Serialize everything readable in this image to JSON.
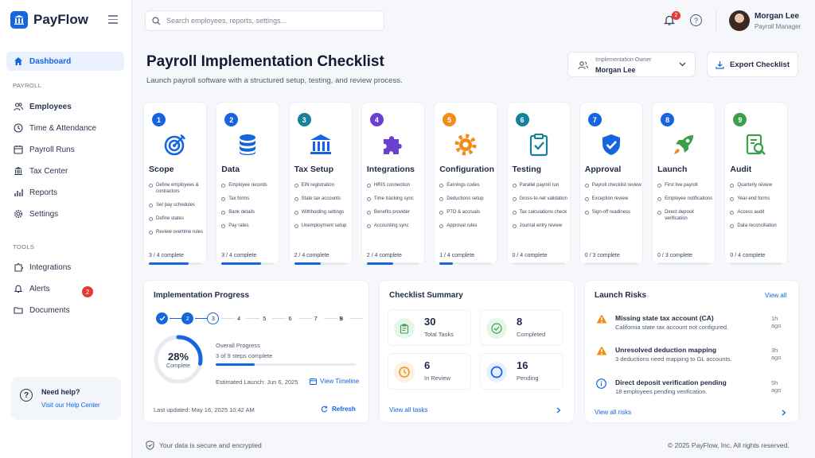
{
  "app": {
    "name": "PayFlow",
    "brand_color": "#1565e0"
  },
  "sidebar": {
    "dashboard": "Dashboard",
    "section_payroll": "PAYROLL",
    "payroll_items": [
      {
        "label": "Employees",
        "icon": "users-icon"
      },
      {
        "label": "Time & Attendance",
        "icon": "clock-icon"
      },
      {
        "label": "Payroll Runs",
        "icon": "calendar-icon"
      },
      {
        "label": "Tax Center",
        "icon": "bank-icon"
      },
      {
        "label": "Reports",
        "icon": "bar-chart-icon"
      },
      {
        "label": "Settings",
        "icon": "gear-icon"
      }
    ],
    "section_tools": "TOOLS",
    "tools_items": [
      {
        "label": "Integrations",
        "icon": "puzzle-icon"
      },
      {
        "label": "Alerts",
        "icon": "bell-icon",
        "badge": "2"
      },
      {
        "label": "Documents",
        "icon": "folder-icon"
      }
    ],
    "help": {
      "title": "Need help?",
      "link": "Visit our Help Center"
    }
  },
  "topbar": {
    "search_placeholder": "Search employees, reports, settings...",
    "notification_count": "2",
    "user": {
      "name": "Morgan Lee",
      "role": "Payroll Manager"
    }
  },
  "header": {
    "title": "Payroll Implementation Checklist",
    "subtitle": "Launch payroll software with a structured setup, testing, and review process.",
    "owner_label": "Implementation Owner",
    "owner_value": "Morgan Lee",
    "export_label": "Export Checklist"
  },
  "stages": [
    {
      "num": "1",
      "name": "Scope",
      "color": "#1565e0",
      "icon": "target-icon",
      "items": [
        "Define employees & contractors",
        "Set pay schedules",
        "Define states",
        "Review overtime rules"
      ],
      "status": "3 / 4 complete",
      "progress": 0.75
    },
    {
      "num": "2",
      "name": "Data",
      "color": "#1565e0",
      "icon": "database-icon",
      "items": [
        "Employee records",
        "Tax forms",
        "Bank details",
        "Pay rates"
      ],
      "status": "3 / 4 complete",
      "progress": 0.75
    },
    {
      "num": "3",
      "name": "Tax Setup",
      "color": "#15829a",
      "icon": "bank-icon",
      "items": [
        "EIN registration",
        "State tax accounts",
        "Withholding settings",
        "Unemployment setup"
      ],
      "status": "2 / 4 complete",
      "progress": 0.5
    },
    {
      "num": "4",
      "name": "Integrations",
      "color": "#6a3fd1",
      "icon": "puzzle-icon",
      "items": [
        "HRIS connection",
        "Time tracking sync",
        "Benefits provider",
        "Accounting sync"
      ],
      "status": "2 / 4 complete",
      "progress": 0.5
    },
    {
      "num": "5",
      "name": "Configuration",
      "color": "#f28c18",
      "icon": "gear-icon",
      "items": [
        "Earnings codes",
        "Deductions setup",
        "PTO & accruals",
        "Approval rules"
      ],
      "status": "1 / 4 complete",
      "progress": 0.25
    },
    {
      "num": "6",
      "name": "Testing",
      "color": "#15829a",
      "icon": "clipboard-check-icon",
      "items": [
        "Parallel payroll run",
        "Gross-to-net validation",
        "Tax calculations check",
        "Journal entry review"
      ],
      "status": "0 / 4 complete",
      "progress": 0
    },
    {
      "num": "7",
      "name": "Approval",
      "color": "#1565e0",
      "icon": "shield-check-icon",
      "items": [
        "Payroll checklist review",
        "Exception review",
        "Sign-off readiness"
      ],
      "status": "0 / 3 complete",
      "progress": 0
    },
    {
      "num": "8",
      "name": "Launch",
      "color": "#1565e0",
      "icon": "rocket-icon",
      "items": [
        "First live payroll",
        "Employee notifications",
        "Direct deposit verification"
      ],
      "status": "0 / 3 complete",
      "progress": 0
    },
    {
      "num": "9",
      "name": "Audit",
      "color": "#3aa14a",
      "icon": "audit-search-icon",
      "items": [
        "Quarterly review",
        "Year-end forms",
        "Access audit",
        "Data reconciliation"
      ],
      "status": "0 / 4 complete",
      "progress": 0
    }
  ],
  "progress_panel": {
    "title": "Implementation Progress",
    "steps": [
      "1",
      "2",
      "3",
      "4",
      "5",
      "6",
      "7",
      "8",
      "9"
    ],
    "percent_label": "28%",
    "percent_value": 0.28,
    "percent_caption": "Complete",
    "overall_label": "Overall Progress",
    "overall_detail": "3 of 9 steps complete",
    "estimated_launch": "Estimated Launch: Jun 6, 2025",
    "view_timeline": "View Timeline",
    "last_updated": "Last updated: May 16, 2025 10:42 AM",
    "refresh": "Refresh"
  },
  "summary_panel": {
    "title": "Checklist Summary",
    "kpis": [
      {
        "value": "30",
        "label": "Total Tasks",
        "icon": "clipboard-icon",
        "color": "#3aa14a"
      },
      {
        "value": "8",
        "label": "Completed",
        "icon": "check-circle-icon",
        "color": "#3aa14a"
      },
      {
        "value": "6",
        "label": "In Review",
        "icon": "clock-icon",
        "color": "#f28c18"
      },
      {
        "value": "16",
        "label": "Pending",
        "icon": "circle-icon",
        "color": "#1565e0"
      }
    ],
    "view_all": "View all tasks"
  },
  "risks_panel": {
    "title": "Launch Risks",
    "view_all": "View all",
    "risks": [
      {
        "title": "Missing state tax account (CA)",
        "desc": "California state tax account not configured.",
        "time": "1h ago",
        "icon": "warning-icon"
      },
      {
        "title": "Unresolved deduction mapping",
        "desc": "3 deductions need mapping to GL accounts.",
        "time": "3h ago",
        "icon": "warning-icon"
      },
      {
        "title": "Direct deposit verification pending",
        "desc": "18 employees pending verification.",
        "time": "5h ago",
        "icon": "info-icon"
      }
    ],
    "view_all_risks": "View all risks"
  },
  "footer": {
    "secure": "Your data is secure and encrypted",
    "copyright": "© 2025 PayFlow, Inc. All rights reserved."
  }
}
